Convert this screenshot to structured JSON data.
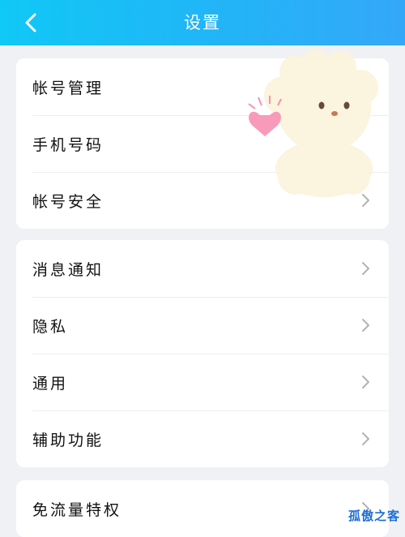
{
  "header": {
    "title": "设置",
    "back_icon": "chevron-left-icon"
  },
  "groups": [
    {
      "items": [
        {
          "label": "帐号管理",
          "chevron": false
        },
        {
          "label": "手机号码",
          "chevron": false
        },
        {
          "label": "帐号安全",
          "chevron": true
        }
      ]
    },
    {
      "items": [
        {
          "label": "消息通知",
          "chevron": true
        },
        {
          "label": "隐私",
          "chevron": true
        },
        {
          "label": "通用",
          "chevron": true
        },
        {
          "label": "辅助功能",
          "chevron": true
        }
      ]
    },
    {
      "items": [
        {
          "label": "免流量特权",
          "chevron": true
        }
      ]
    }
  ],
  "watermark": "孤傲之客",
  "colors": {
    "header_start": "#10c8f6",
    "header_end": "#34a8f8",
    "chevron": "#b3b3b3",
    "watermark": "#1e6fd6"
  }
}
